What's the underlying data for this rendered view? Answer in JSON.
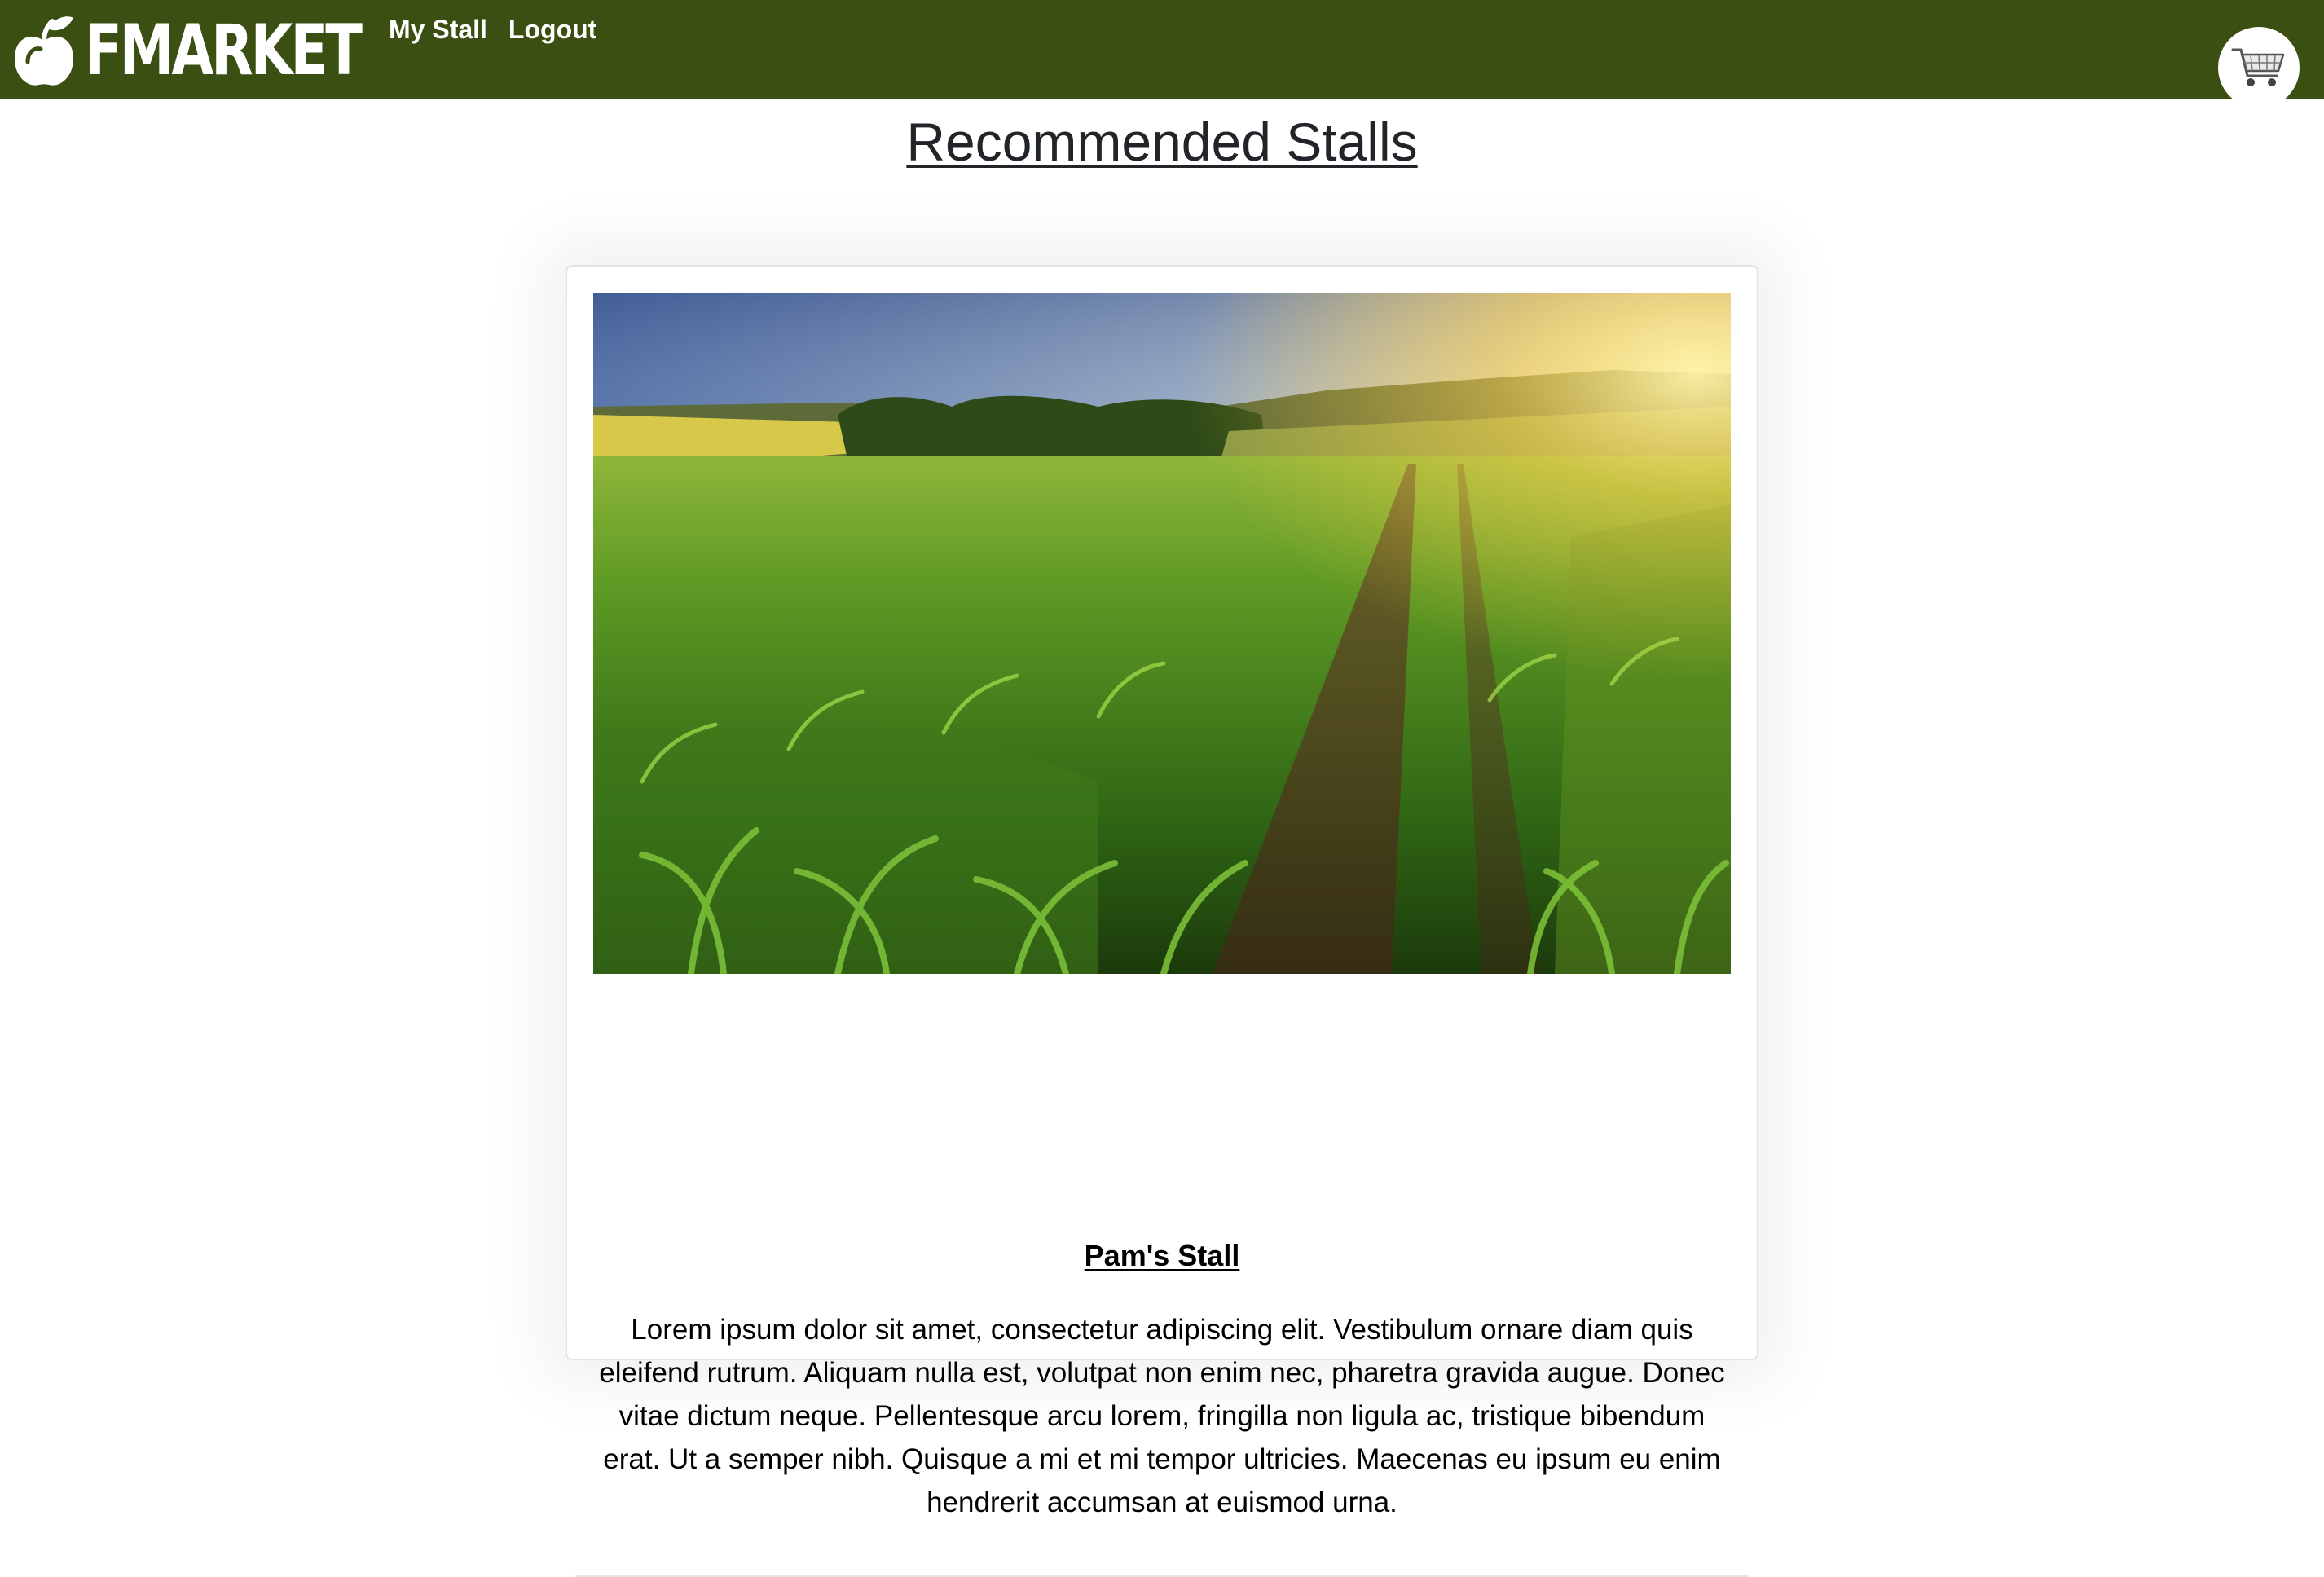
{
  "brand": {
    "name": "FMARKET",
    "logo_icon": "apple-icon"
  },
  "nav": {
    "my_stall": "My Stall",
    "logout": "Logout",
    "cart_icon": "shopping-cart-icon"
  },
  "page": {
    "title": "Recommended Stalls"
  },
  "stalls": [
    {
      "name": "Pam's Stall",
      "image_icon": "farm-field-image",
      "description": "Lorem ipsum dolor sit amet, consectetur adipiscing elit. Vestibulum ornare diam quis eleifend rutrum. Aliquam nulla est, volutpat non enim nec, pharetra gravida augue. Donec vitae dictum neque. Pellentesque arcu lorem, fringilla non ligula ac, tristique bibendum erat. Ut a semper nibh. Quisque a mi et mi tempor ultricies. Maecenas eu ipsum eu enim hendrerit accumsan at euismod urna."
    }
  ],
  "colors": {
    "navbar": "#3b4f12",
    "title_text": "#212529"
  }
}
